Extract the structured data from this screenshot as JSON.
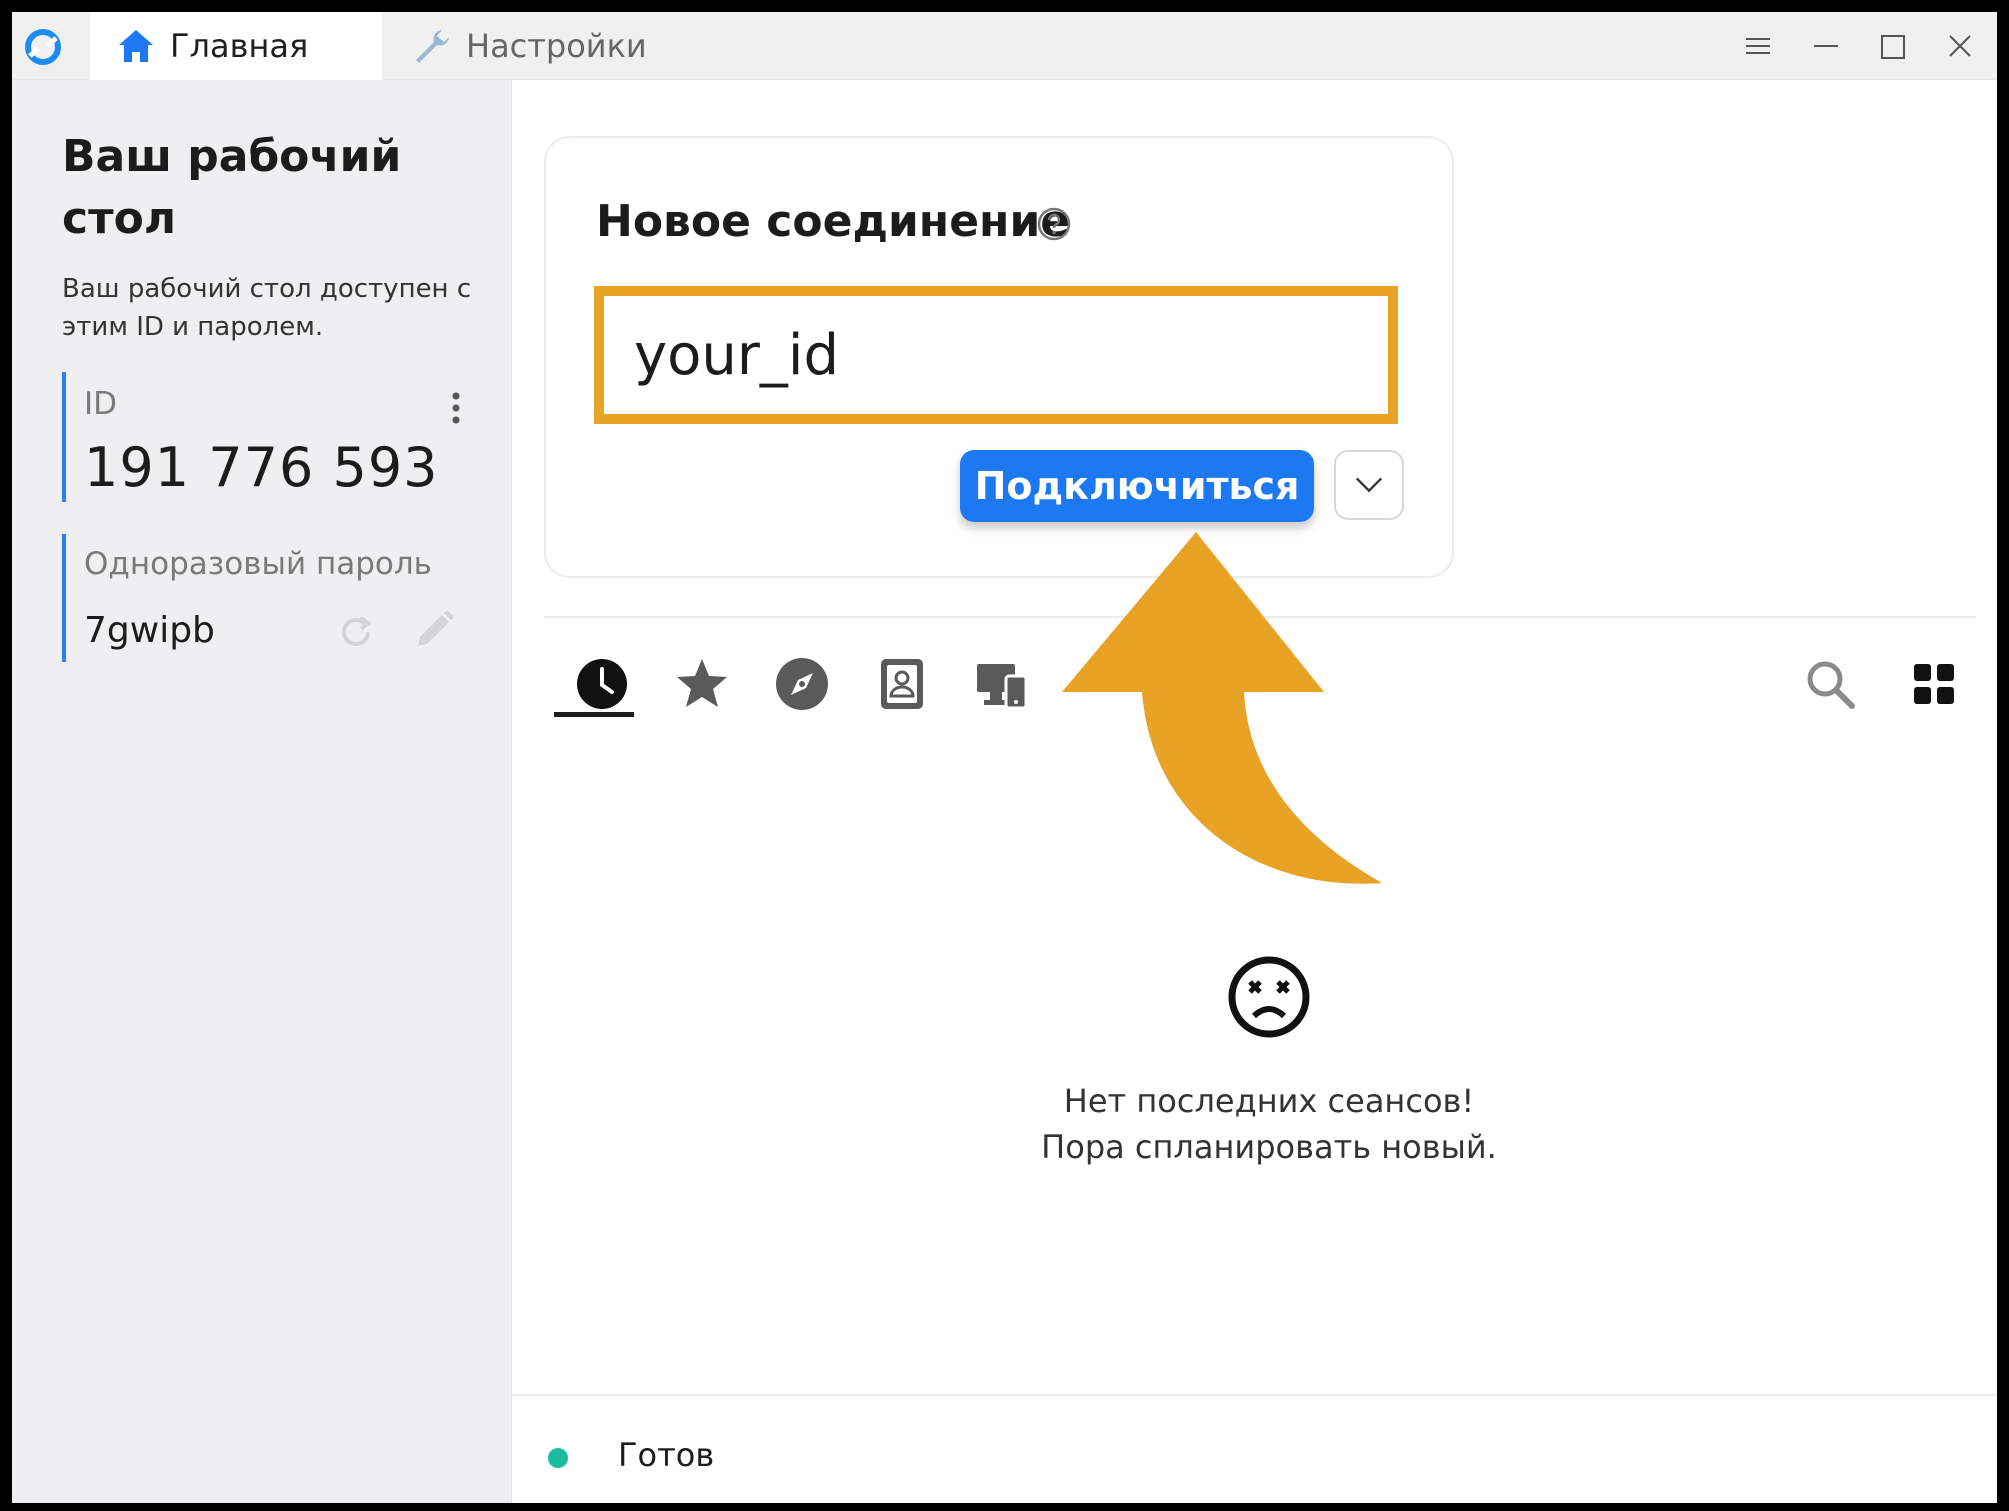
{
  "window": {
    "tabs": [
      {
        "label": "Главная",
        "icon": "home-icon",
        "active": true
      },
      {
        "label": "Настройки",
        "icon": "wrench-icon",
        "active": false
      }
    ]
  },
  "sidebar": {
    "title": "Ваш рабочий стол",
    "description": "Ваш рабочий стол доступен с этим ID и паролем.",
    "id_label": "ID",
    "id_value": "191 776 593",
    "password_label": "Одноразовый пароль",
    "password_value": "7gwipb"
  },
  "connection": {
    "title": "Новое соединение",
    "input_value": "your_id",
    "connect_label": "Подключиться"
  },
  "sessions": {
    "tabs": [
      "recent-sessions",
      "favorites",
      "discovered",
      "address-book",
      "accessible-devices"
    ],
    "empty_line1": "Нет последних сеансов!",
    "empty_line2": "Пора спланировать новый."
  },
  "status": {
    "text": "Готов",
    "color": "#1abc9c"
  },
  "colors": {
    "accent": "#1d79f2",
    "highlight": "#e8a226"
  }
}
